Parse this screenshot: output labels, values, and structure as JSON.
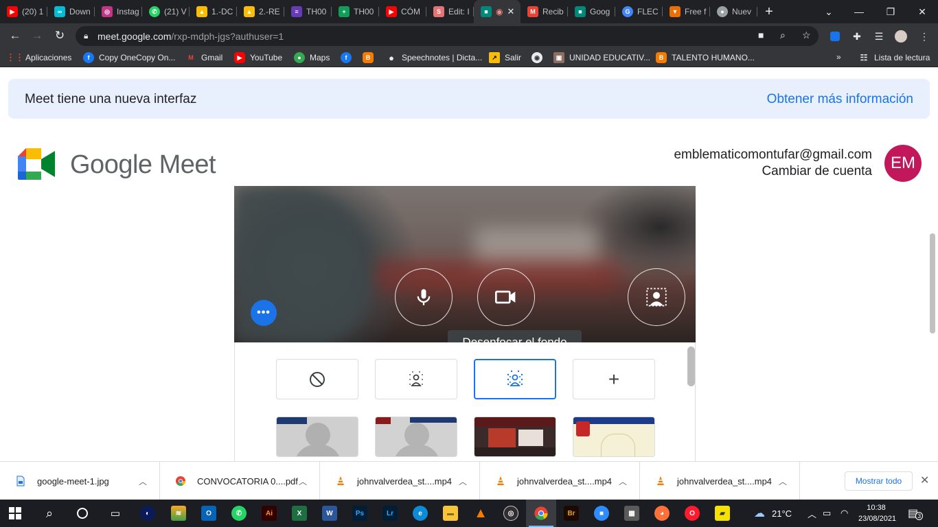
{
  "browser": {
    "tabs": [
      {
        "label": "(20) 1",
        "color": "#ff0000"
      },
      {
        "label": "Down",
        "color": "#00bcd4"
      },
      {
        "label": "Instag",
        "color": "#c13584"
      },
      {
        "label": "(21) V",
        "color": "#25d366"
      },
      {
        "label": "1.-DC",
        "color": "#fbbc04"
      },
      {
        "label": "2.-RE",
        "color": "#fbbc04"
      },
      {
        "label": "TH00",
        "color": "#673ab7"
      },
      {
        "label": "TH00",
        "color": "#0f9d58"
      },
      {
        "label": "CÓM",
        "color": "#ff0000"
      },
      {
        "label": "Edit: I",
        "color": "#e57373"
      },
      {
        "label": "",
        "color": "#00897b",
        "active": true
      },
      {
        "label": "Recib",
        "color": "#ea4335"
      },
      {
        "label": "Goog",
        "color": "#00897b"
      },
      {
        "label": "FLEC",
        "color": "#4285f4"
      },
      {
        "label": "Free f",
        "color": "#ef6c00"
      },
      {
        "label": "Nuev",
        "color": "#9aa0a6"
      }
    ],
    "url_host": "meet.google.com",
    "url_path": "/rxp-mdph-jgs?authuser=1",
    "bookmarks": [
      {
        "label": "Aplicaciones",
        "color": "#4285f4"
      },
      {
        "label": "Copy OneCopy On...",
        "color": "#1877f2"
      },
      {
        "label": "Gmail",
        "color": "#ea4335"
      },
      {
        "label": "YouTube",
        "color": "#ff0000"
      },
      {
        "label": "Maps",
        "color": "#34a853"
      },
      {
        "label": "",
        "color": "#1877f2"
      },
      {
        "label": "",
        "color": "#f57c00"
      },
      {
        "label": "Speechnotes | Dicta...",
        "color": "#202124"
      },
      {
        "label": "Salir",
        "color": "#fbbc04"
      },
      {
        "label": "",
        "color": "#e8eaed"
      },
      {
        "label": "UNIDAD EDUCATIV...",
        "color": "#8d6e63"
      },
      {
        "label": "TALENTO HUMANO...",
        "color": "#f57c00"
      }
    ],
    "reading_list": "Lista de lectura"
  },
  "banner": {
    "text": "Meet tiene una nueva interfaz",
    "link": "Obtener más información"
  },
  "brand": {
    "name": "Google Meet"
  },
  "account": {
    "email": "emblematicomontufar@gmail.com",
    "switch": "Cambiar de cuenta",
    "initials": "EM",
    "avatar_color": "#c2185b"
  },
  "preview": {
    "tooltip": "Desenfocar el fondo"
  },
  "downloads": [
    {
      "name": "google-meet-1.jpg",
      "icon": "file-icon"
    },
    {
      "name": "CONVOCATORIA 0....pdf",
      "icon": "chrome-icon"
    },
    {
      "name": "johnvalverdea_st....mp4",
      "icon": "vlc-icon"
    },
    {
      "name": "johnvalverdea_st....mp4",
      "icon": "vlc-icon"
    },
    {
      "name": "johnvalverdea_st....mp4",
      "icon": "vlc-icon"
    }
  ],
  "show_all": "Mostrar todo",
  "taskbar": {
    "weather": "21°C",
    "time": "10:38",
    "date": "23/08/2021",
    "notifications": "3"
  }
}
